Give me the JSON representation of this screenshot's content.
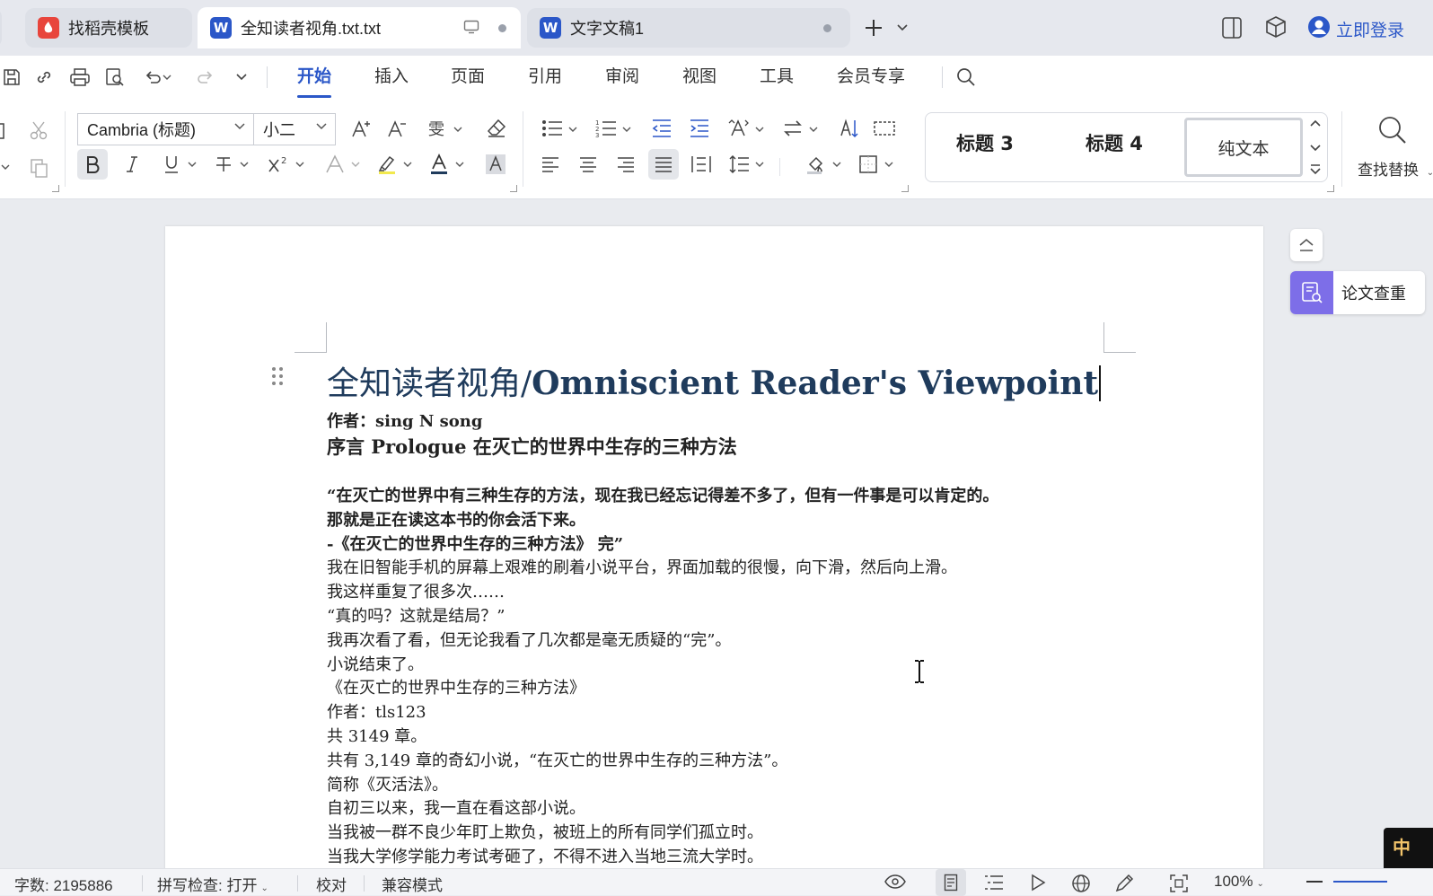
{
  "tabs": [
    {
      "label": "找稻壳模板",
      "icon": "docer-icon",
      "color": "#e8453c",
      "active": false
    },
    {
      "label": "全知读者视角.txt.txt",
      "icon": "wps-writer-icon",
      "color": "#2b57c8",
      "active": true
    },
    {
      "label": "文字文稿1",
      "icon": "wps-writer-icon",
      "color": "#2b57c8",
      "active": false
    }
  ],
  "topbar": {
    "login_label": "立即登录"
  },
  "menu": [
    "开始",
    "插入",
    "页面",
    "引用",
    "审阅",
    "视图",
    "工具",
    "会员专享"
  ],
  "ribbon": {
    "font_name": "Cambria (标题)",
    "font_size": "小二",
    "styles": [
      "标题 3",
      "标题 4",
      "纯文本"
    ],
    "find_replace_label": "查找替换"
  },
  "floaters": {
    "paper_check_label": "论文查重"
  },
  "document": {
    "title_cjk": "全知读者视角/",
    "title_latin": "Omniscient Reader's Viewpoint",
    "lines": [
      {
        "text": "作者：sing N song",
        "bold": true
      },
      {
        "text": "序言 Prologue 在灭亡的世界中生存的三种方法",
        "bold": true,
        "size": 21
      },
      {
        "text": "",
        "bold": false
      },
      {
        "text": "“在灭亡的世界中有三种生存的方法，现在我已经忘记得差不多了，但有一件事是可以肯定的。",
        "bold": true
      },
      {
        "text": "那就是正在读这本书的你会活下来。",
        "bold": true
      },
      {
        "text": "-《在灭亡的世界中生存的三种方法》 完”",
        "bold": true
      },
      {
        "text": "我在旧智能手机的屏幕上艰难的刷着小说平台，界面加载的很慢，向下滑，然后向上滑。",
        "bold": false
      },
      {
        "text": "我这样重复了很多次……",
        "bold": false
      },
      {
        "text": "“真的吗？这就是结局？”",
        "bold": false
      },
      {
        "text": "我再次看了看，但无论我看了几次都是毫无质疑的“完”。",
        "bold": false
      },
      {
        "text": "小说结束了。",
        "bold": false
      },
      {
        "text": "《在灭亡的世界中生存的三种方法》",
        "bold": false
      },
      {
        "text": "作者：tls123",
        "bold": false
      },
      {
        "text": "共 3149 章。",
        "bold": false
      },
      {
        "text": "共有 3,149 章的奇幻小说，“在灭亡的世界中生存的三种方法”。",
        "bold": false
      },
      {
        "text": "简称《灭活法》。",
        "bold": false
      },
      {
        "text": "自初三以来，我一直在看这部小说。",
        "bold": false
      },
      {
        "text": "当我被一群不良少年盯上欺负，被班上的所有同学们孤立时。",
        "bold": false
      },
      {
        "text": "当我大学修学能力考试考砸了，不得不进入当地三流大学时。",
        "bold": false
      }
    ]
  },
  "statusbar": {
    "word_count": "字数: 2195886",
    "spell_check": "拼写检查: 打开",
    "proofread": "校对",
    "compat_mode": "兼容模式",
    "zoom": "100%"
  },
  "colors": {
    "accent": "#2b57c8",
    "title": "#1f3b5c",
    "paper_check": "#7d6ee8"
  }
}
